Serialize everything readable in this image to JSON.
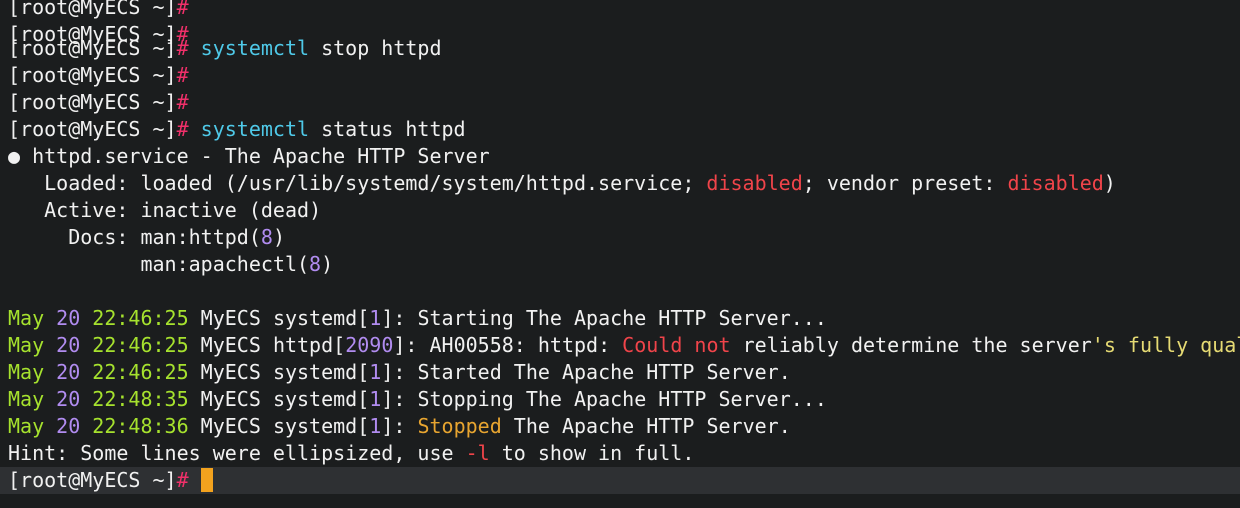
{
  "prompt": {
    "user_host": "[root@MyECS ~]",
    "symbol": "#"
  },
  "cmd1": {
    "cmd": "systemctl",
    "args": " stop httpd"
  },
  "cmd2": {
    "cmd": "systemctl",
    "args": " status httpd"
  },
  "status": {
    "bullet": "●",
    "unit": " httpd.service",
    "dash": " - ",
    "description": "The Apache HTTP Server",
    "loaded_key": "   Loaded",
    "loaded_colon": ":",
    "loaded_val": " loaded ",
    "loaded_paren_open": "(",
    "loaded_path": "/usr/lib/systemd/system/httpd.service",
    "semi1": ";",
    "disabled1": " disabled",
    "semi2": ";",
    "vendor_preset": " vendor preset",
    "colon2": ":",
    "disabled2": " disabled",
    "paren_close": ")",
    "active_key": "   Active",
    "active_colon": ":",
    "active_val": " inactive ",
    "active_paren_open": "(",
    "active_dead": "dead",
    "active_paren_close": ")",
    "docs_key": "     Docs",
    "docs_colon": ":",
    "doc1_man": " man",
    "doc1_colon": ":",
    "doc1_name": "httpd",
    "doc1_po": "(",
    "doc1_num": "8",
    "doc1_pc": ")",
    "doc2_indent": "           man",
    "doc2_colon": ":",
    "doc2_name": "apachectl",
    "doc2_po": "(",
    "doc2_num": "8",
    "doc2_pc": ")"
  },
  "logs": [
    {
      "month": "May ",
      "day": "20",
      "time": " 22:46:25",
      "host": " MyECS ",
      "proc": "systemd",
      "bo": "[",
      "pid": "1",
      "bc": "]",
      "colon": ":",
      "msg": " Starting The Apache HTTP Server..."
    },
    {
      "month": "May ",
      "day": "20",
      "time": " 22:46:25",
      "host": " MyECS ",
      "proc": "httpd",
      "bo": "[",
      "pid": "2090",
      "bc": "]",
      "colon": ":",
      "code": " AH00558",
      "code_colon": ":",
      "msg_a": " httpd",
      "msg_colon": ":",
      "could": " Could not",
      "msg_b": " reliably determine the server",
      "fully": "'s fully qualifi"
    },
    {
      "month": "May ",
      "day": "20",
      "time": " 22:46:25",
      "host": " MyECS ",
      "proc": "systemd",
      "bo": "[",
      "pid": "1",
      "bc": "]",
      "colon": ":",
      "msg": " Started The Apache HTTP Server."
    },
    {
      "month": "May ",
      "day": "20",
      "time": " 22:48:35",
      "host": " MyECS ",
      "proc": "systemd",
      "bo": "[",
      "pid": "1",
      "bc": "]",
      "colon": ":",
      "msg": " Stopping The Apache HTTP Server..."
    },
    {
      "month": "May ",
      "day": "20",
      "time": " 22:48:36",
      "host": " MyECS ",
      "proc": "systemd",
      "bo": "[",
      "pid": "1",
      "bc": "]",
      "colon": ":",
      "stopped": " Stopped",
      "msg": " The Apache HTTP Server."
    }
  ],
  "hint": {
    "key": "Hint",
    "colon": ":",
    "text_a": " Some lines were ellipsized, use ",
    "flag": "-l",
    "text_b": " to show in full."
  },
  "colors": {
    "background": "#1b1d1e",
    "prompt_symbol": "#f0306a",
    "command": "#4fc9e8",
    "disabled": "#f0444a",
    "number": "#b18cf0",
    "cursor": "#f2a21e"
  }
}
